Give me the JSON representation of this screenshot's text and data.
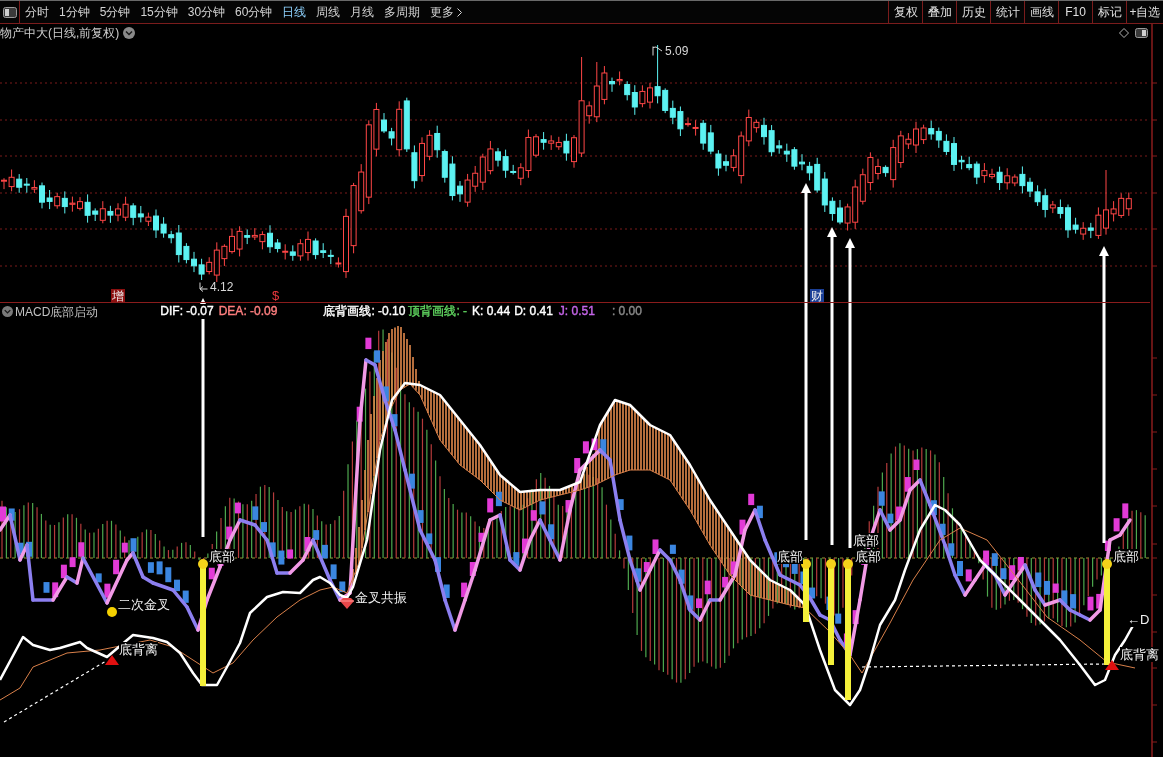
{
  "toolbar": {
    "periods": [
      {
        "label": "分时",
        "selected": false
      },
      {
        "label": "1分钟",
        "selected": false
      },
      {
        "label": "5分钟",
        "selected": false
      },
      {
        "label": "15分钟",
        "selected": false
      },
      {
        "label": "30分钟",
        "selected": false
      },
      {
        "label": "60分钟",
        "selected": false
      },
      {
        "label": "日线",
        "selected": true
      },
      {
        "label": "周线",
        "selected": false
      },
      {
        "label": "月线",
        "selected": false
      },
      {
        "label": "多周期",
        "selected": false
      }
    ],
    "more": "更多",
    "actions": [
      "复权",
      "叠加",
      "历史",
      "统计",
      "画线",
      "F10",
      "标记",
      "+自选"
    ]
  },
  "price_chart": {
    "title": "物产中大(日线,前复权)",
    "high_label": "5.09",
    "low_label": "4.12",
    "markers": [
      {
        "text": "增",
        "kind": "filled",
        "color": "#8b1010"
      },
      {
        "text": "$",
        "kind": "plain",
        "color": "#e8383d"
      },
      {
        "text": "财",
        "kind": "filled",
        "color": "#1b3f96"
      }
    ]
  },
  "indicator": {
    "name": "MACD底部启动",
    "readouts": [
      {
        "text": "DIF: -0.07",
        "color": "#ffffff"
      },
      {
        "text": "DEA: -0.09",
        "color": "#ff7f7f"
      },
      {
        "text": "底背画线: -0.10",
        "color": "#ffffff"
      },
      {
        "text": "顶背画线: -",
        "color": "#5fd35f"
      },
      {
        "text": "K: 0.44",
        "color": "#ffffff"
      },
      {
        "text": "D: 0.41",
        "color": "#ffffff"
      },
      {
        "text": "J: 0.51",
        "color": "#c565e8"
      },
      {
        "text": ": 0.00",
        "color": "#8a8a8a"
      }
    ],
    "annotations": [
      {
        "kind": "bottom",
        "text": "底部"
      },
      {
        "kind": "dot",
        "text": "二次金叉"
      },
      {
        "kind": "divergence",
        "text": "底背离"
      },
      {
        "kind": "resonance",
        "text": "金叉共振"
      },
      {
        "kind": "bottom",
        "text": "底部"
      },
      {
        "kind": "bottom",
        "text": "底部"
      },
      {
        "kind": "bottom",
        "text": "底部"
      },
      {
        "kind": "bottom",
        "text": "底部"
      },
      {
        "kind": "divergence",
        "text": "底背离"
      },
      {
        "kind": "line_label",
        "text": "←D"
      }
    ]
  }
}
